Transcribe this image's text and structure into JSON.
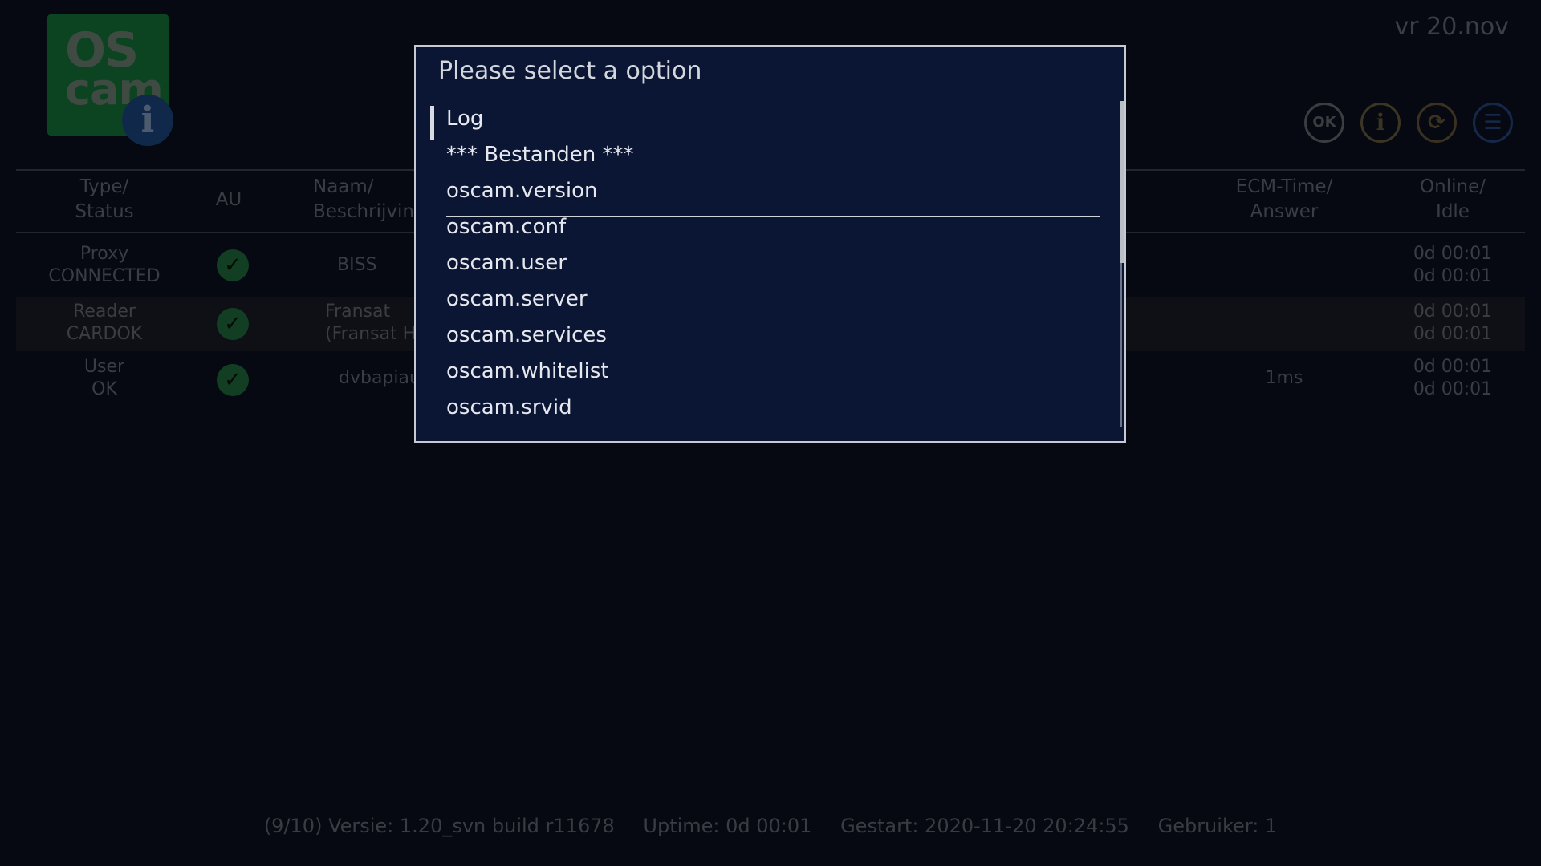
{
  "logo": {
    "line1": "OS",
    "line2": "cam",
    "badge": "i",
    "colors": {
      "background": "#0c4422",
      "badge": "#10294a"
    }
  },
  "clock": "vr 20.nov",
  "toolbar": {
    "icons": [
      {
        "name": "ok-icon",
        "label": "OK"
      },
      {
        "name": "info-icon",
        "label": "i"
      },
      {
        "name": "refresh-icon",
        "label": "⟳"
      },
      {
        "name": "menu-icon",
        "label": "☰"
      }
    ]
  },
  "table": {
    "headers": {
      "type_status": "Type/\nStatus",
      "au": "AU",
      "name_desc": "Naam/\nBeschrijvin",
      "ecm_time": "ECM-Time/\nAnswer",
      "online_idle": "Online/\nIdle"
    },
    "rows": [
      {
        "type_status": "Proxy\nCONNECTED",
        "name": "BISS",
        "ecm": "",
        "online_idle": "0d 00:01\n0d 00:01"
      },
      {
        "type_status": "Reader\nCARDOK",
        "name": "Fransat\n(Fransat H",
        "ecm": "",
        "online_idle": "0d 00:01\n0d 00:01"
      },
      {
        "type_status": "User\nOK",
        "name": "dvbapiau",
        "ecm": "1ms",
        "online_idle": "0d 00:01\n0d 00:01"
      }
    ]
  },
  "status_bar": {
    "version": "(9/10) Versie: 1.20_svn build r11678",
    "uptime": "Uptime: 0d 00:01",
    "started": "Gestart: 2020-11-20 20:24:55",
    "user": "Gebruiker: 1"
  },
  "dialog": {
    "title": "Please select a option",
    "options": [
      "Log",
      "*** Bestanden ***",
      "oscam.version",
      "oscam.conf",
      "oscam.user",
      "oscam.server",
      "oscam.services",
      "oscam.whitelist",
      "oscam.srvid"
    ],
    "selected_index": 0,
    "colors": {
      "background": "#0b1634",
      "border": "#c6cad2",
      "text": "#e6e8ee"
    }
  }
}
